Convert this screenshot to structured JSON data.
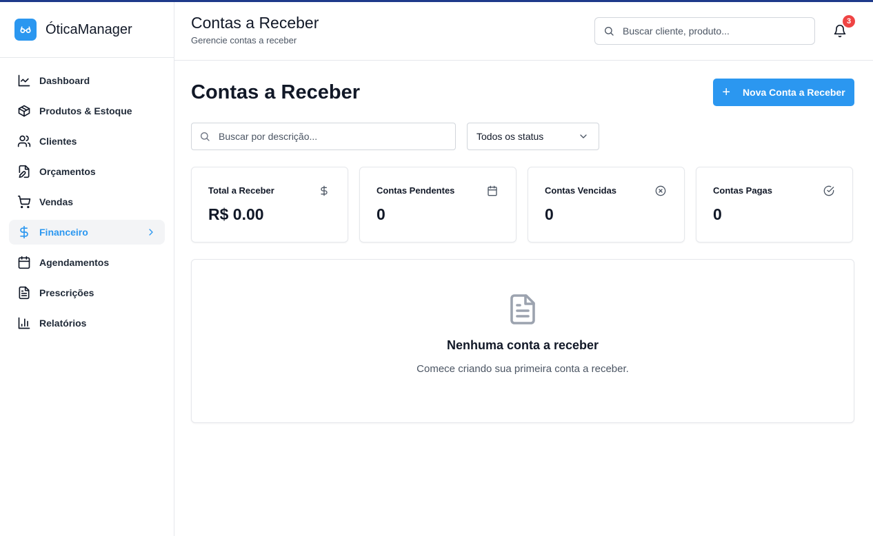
{
  "app": {
    "name": "ÓticaManager",
    "logo_icon": "glasses-icon"
  },
  "sidebar": {
    "items": [
      {
        "label": "Dashboard",
        "icon": "chart-line-icon"
      },
      {
        "label": "Produtos & Estoque",
        "icon": "package-icon"
      },
      {
        "label": "Clientes",
        "icon": "users-icon"
      },
      {
        "label": "Orçamentos",
        "icon": "file-edit-icon"
      },
      {
        "label": "Vendas",
        "icon": "cart-icon"
      },
      {
        "label": "Financeiro",
        "icon": "dollar-icon",
        "active": true
      },
      {
        "label": "Agendamentos",
        "icon": "calendar-icon"
      },
      {
        "label": "Prescrições",
        "icon": "file-text-icon"
      },
      {
        "label": "Relatórios",
        "icon": "bar-chart-icon"
      }
    ]
  },
  "header": {
    "title": "Contas a Receber",
    "subtitle": "Gerencie contas a receber",
    "search_placeholder": "Buscar cliente, produto...",
    "notifications_count": "3"
  },
  "page": {
    "title": "Contas a Receber",
    "new_button_label": "Nova Conta a Receber",
    "search_placeholder": "Buscar por descrição...",
    "status_filter": "Todos os status"
  },
  "stats": [
    {
      "label": "Total a Receber",
      "value": "R$ 0.00",
      "icon": "dollar-icon"
    },
    {
      "label": "Contas Pendentes",
      "value": "0",
      "icon": "calendar-icon"
    },
    {
      "label": "Contas Vencidas",
      "value": "0",
      "icon": "x-circle-icon"
    },
    {
      "label": "Contas Pagas",
      "value": "0",
      "icon": "check-circle-icon"
    }
  ],
  "empty_state": {
    "title": "Nenhuma conta a receber",
    "description": "Comece criando sua primeira conta a receber."
  },
  "colors": {
    "accent": "#2b97f0",
    "badge": "#ef4444",
    "top_border": "#1e3a8a"
  }
}
